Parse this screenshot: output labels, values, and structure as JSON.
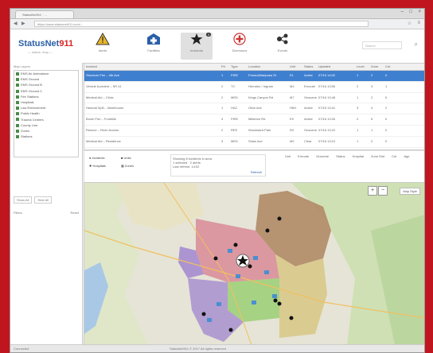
{
  "browser": {
    "tab_title": "StatusNet911 · ...",
    "url": "https://www.statusnet911.com/...",
    "window_controls": [
      "–",
      "□",
      "×"
    ]
  },
  "app": {
    "logo_main": "StatusNet",
    "logo_accent": "911",
    "logo_tagline": "— status, map —"
  },
  "toolbar": {
    "items": [
      {
        "label": "Alerts",
        "icon": "warning-icon",
        "color": "#e8b82a"
      },
      {
        "label": "Facilities",
        "icon": "hospital-icon",
        "color": "#2a5fa8"
      },
      {
        "label": "Incidents",
        "icon": "star-icon",
        "color": "#222222",
        "badge": "3"
      },
      {
        "label": "Diversions",
        "icon": "medical-icon",
        "color": "#cc3333"
      },
      {
        "label": "Events",
        "icon": "network-icon",
        "color": "#333333"
      }
    ],
    "search_placeholder": "Search"
  },
  "sidebar": {
    "title": "Map Layers",
    "layers": [
      "EMS Air Ambulance",
      "EMS Ground",
      "EMS Ground B",
      "EMS Ground C",
      "Fire Stations",
      "Hospitals",
      "Law Enforcement",
      "Public Health",
      "Trauma Centers",
      "County Line",
      "Zones",
      "Stations"
    ],
    "buttons": [
      "Show All",
      "Hide All"
    ],
    "footer_left": "Filters",
    "footer_right": "Reset"
  },
  "table": {
    "headers": [
      "Incident",
      "Pri",
      "Type",
      "Location",
      "Unit",
      "Status",
      "Updated",
      "Level",
      "Zone",
      "Cnt"
    ],
    "rows": [
      [
        "Structure Fire – 4th Ave",
        "1",
        "FIRE",
        "Fresno/Mariposa St",
        "E1",
        "Active",
        "07/16 14:02",
        "1",
        "2",
        "0"
      ],
      [
        "Vehicle Accident – SR 41",
        "2",
        "TC",
        "Herndon / Ingram",
        "M4",
        "Enroute",
        "07/16 13:55",
        "2",
        "3",
        "1"
      ],
      [
        "Medical Aid – Clinic",
        "2",
        "MED",
        "Kings Canyon Rd",
        "M7",
        "Onscene",
        "07/16 13:48",
        "1",
        "2",
        "0"
      ],
      [
        "Hazmat Spill – Warehouse",
        "1",
        "HAZ",
        "Olive Ave",
        "HM1",
        "Active",
        "07/16 13:41",
        "3",
        "4",
        "2"
      ],
      [
        "Brush Fire – Foothills",
        "3",
        "FIRE",
        "Millerton Rd",
        "E9",
        "Active",
        "07/16 13:30",
        "2",
        "5",
        "0"
      ],
      [
        "Rescue – River Access",
        "2",
        "RES",
        "Woodward Park",
        "R2",
        "Onscene",
        "07/16 13:22",
        "1",
        "1",
        "0"
      ],
      [
        "Medical Aid – Residence",
        "3",
        "MED",
        "Shaw Ave",
        "M2",
        "Clear",
        "07/16 13:10",
        "1",
        "2",
        "0"
      ],
      [
        "Alarm – Commercial",
        "4",
        "ALM",
        "Blackstone Ave",
        "E5",
        "Clear",
        "07/16 13:01",
        "1",
        "3",
        "0"
      ]
    ]
  },
  "controls": {
    "legend": [
      "Incidents",
      "Units",
      "Hospitals",
      "Zones"
    ],
    "panel_lines": [
      "Showing 8 incidents in area",
      "1 selected · 2 alerts",
      "Last refresh: 14:02"
    ],
    "panel_action": "Refresh",
    "columns": [
      "Unit",
      "Enroute",
      "Onscene",
      "Status",
      "Hospital",
      "Zone Dist",
      "Cnt",
      "Age"
    ]
  },
  "map": {
    "layer_chip": "Map Style",
    "zoom_in": "+",
    "zoom_out": "−"
  },
  "status": {
    "left": "Connected",
    "center": "StatusNet911 © 2017 All rights reserved"
  },
  "colors": {
    "frame": "#c0151f",
    "accent": "#2a5fa8",
    "selected_row": "#3f7fd0",
    "zone_brown": "#b08a66",
    "zone_pink": "#d98f9a",
    "zone_purple": "#a58bd0",
    "zone_green": "#9fcf7a",
    "zone_tan": "#d8c88a"
  }
}
